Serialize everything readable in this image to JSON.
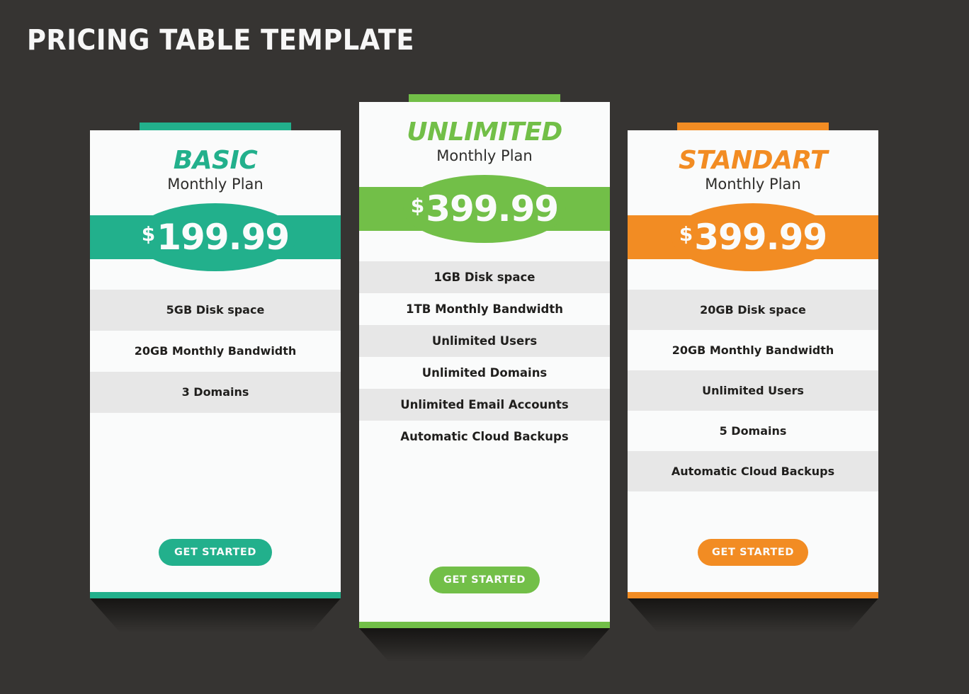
{
  "page": {
    "title": "PRICING TABLE TEMPLATE",
    "background_color": "#363432"
  },
  "colors": {
    "basic_accent": "#22b08c",
    "unlimited_accent": "#72bf48",
    "standart_accent": "#f28c23",
    "card_background": "#fafbfb",
    "row_alt_background": "#e7e7e7",
    "text_dark": "#201f1d",
    "text_light": "#fafbfb"
  },
  "plans": [
    {
      "id": "basic",
      "name": "BASIC",
      "period": "Monthly Plan",
      "currency": "$",
      "price": "199.99",
      "accent": "#22b08c",
      "features": [
        "5GB Disk space",
        "20GB Monthly Bandwidth",
        "3 Domains"
      ],
      "cta_label": "GET STARTED"
    },
    {
      "id": "unlimited",
      "name": "UNLIMITED",
      "period": "Monthly Plan",
      "currency": "$",
      "price": "399.99",
      "accent": "#72bf48",
      "features": [
        "1GB Disk space",
        "1TB Monthly Bandwidth",
        "Unlimited Users",
        "Unlimited Domains",
        "Unlimited Email Accounts",
        "Automatic Cloud Backups"
      ],
      "cta_label": "GET STARTED"
    },
    {
      "id": "standart",
      "name": "STANDART",
      "period": "Monthly Plan",
      "currency": "$",
      "price": "399.99",
      "accent": "#f28c23",
      "features": [
        "20GB Disk space",
        "20GB Monthly Bandwidth",
        "Unlimited Users",
        "5 Domains",
        "Automatic Cloud Backups"
      ],
      "cta_label": "GET STARTED"
    }
  ]
}
